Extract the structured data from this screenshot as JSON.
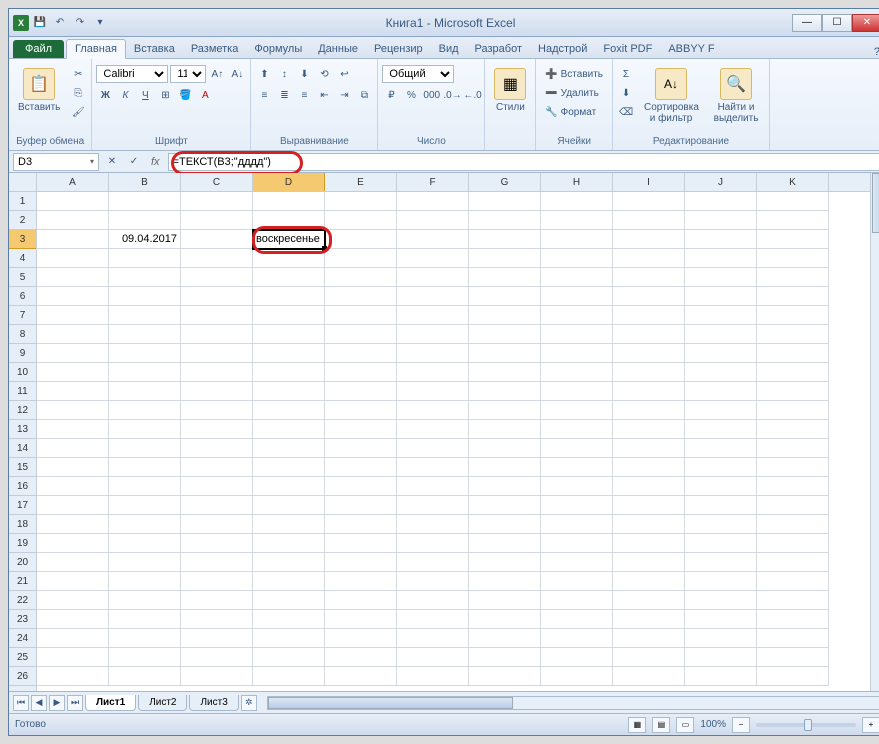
{
  "title": "Книга1 - Microsoft Excel",
  "tabs": {
    "file": "Файл",
    "home": "Главная",
    "insert": "Вставка",
    "layout": "Разметка",
    "formulas": "Формулы",
    "data": "Данные",
    "review": "Рецензир",
    "view": "Вид",
    "dev": "Разработ",
    "add": "Надстрой",
    "foxit": "Foxit PDF",
    "abbyy": "ABBYY F"
  },
  "groups": {
    "clipboard": "Буфер обмена",
    "font": "Шрифт",
    "align": "Выравнивание",
    "number": "Число",
    "styles": "Стили",
    "cells": "Ячейки",
    "editing": "Редактирование"
  },
  "ribbon": {
    "paste": "Вставить",
    "font_name": "Calibri",
    "font_size": "11",
    "number_fmt": "Общий",
    "styles": "Стили",
    "insert": "Вставить",
    "delete": "Удалить",
    "format": "Формат",
    "sort": "Сортировка и фильтр",
    "find": "Найти и выделить"
  },
  "namebox": "D3",
  "formula": "=ТЕКСТ(B3;\"дддд\")",
  "columns": [
    "A",
    "B",
    "C",
    "D",
    "E",
    "F",
    "G",
    "H",
    "I",
    "J",
    "K"
  ],
  "rows": [
    "1",
    "2",
    "3",
    "4",
    "5",
    "6",
    "7",
    "8",
    "9",
    "10",
    "11",
    "12",
    "13",
    "14",
    "15",
    "16",
    "17",
    "18",
    "19",
    "20",
    "21",
    "22",
    "23",
    "24",
    "25",
    "26"
  ],
  "cell_b3": "09.04.2017",
  "cell_d3": "воскресенье",
  "sheets": {
    "s1": "Лист1",
    "s2": "Лист2",
    "s3": "Лист3"
  },
  "status": "Готово",
  "zoom": "100%",
  "icons": {
    "minus": "−",
    "plus": "+",
    "help": "?"
  }
}
